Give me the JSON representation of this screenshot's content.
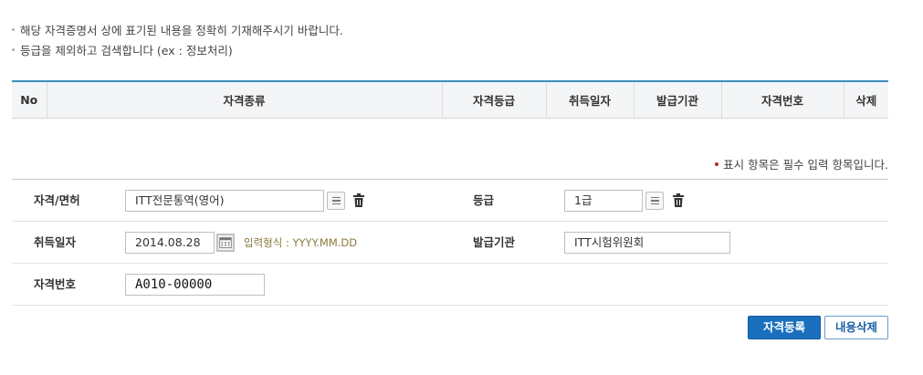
{
  "notes": [
    "해당 자격증명서 상에 표기된 내용을 정확히 기재해주시기 바랍니다.",
    "등급을 제외하고 검색합니다 (ex : 정보처리)"
  ],
  "table": {
    "headers": [
      "No",
      "자격종류",
      "자격등급",
      "취득일자",
      "발급기관",
      "자격번호",
      "삭제"
    ]
  },
  "required_note": "표시 항목은 필수 입력 항목입니다.",
  "form": {
    "license_label": "자격/면허",
    "license_value": "ITT전문통역(영어)",
    "grade_label": "등급",
    "grade_value": "1급",
    "date_label": "취득일자",
    "date_value": "2014.08.28",
    "date_hint": "입력형식 : YYYY.MM.DD",
    "issuer_label": "발급기관",
    "issuer_value": "ITT시험위원회",
    "number_label": "자격번호",
    "number_value": "A010-00000"
  },
  "buttons": {
    "register": "자격등록",
    "clear": "내용삭제"
  },
  "colors": {
    "accent": "#3b8fbf",
    "primary_button": "#1a70bd",
    "required_dot": "#c0272d"
  }
}
